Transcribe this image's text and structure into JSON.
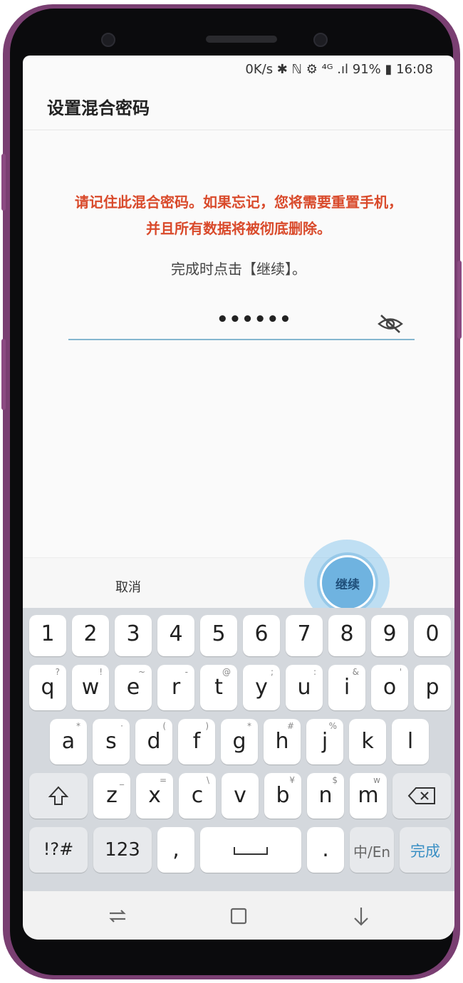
{
  "status_bar": {
    "text": "0K/s ✱ ℕ ⚙ ⁴ᴳ .ıl 91% ▮ 16:08",
    "battery": "91%",
    "time": "16:08"
  },
  "title": "设置混合密码",
  "warning_line1": "请记住此混合密码。如果忘记，您将需要重置手机，",
  "warning_line2": "并且所有数据将被彻底删除。",
  "hint": "完成时点击【继续】。",
  "password": {
    "masked_value": "••••••",
    "visibility_icon": "eye-off-icon"
  },
  "buttons": {
    "cancel": "取消",
    "continue": "继续"
  },
  "keyboard": {
    "row1": [
      "1",
      "2",
      "3",
      "4",
      "5",
      "6",
      "7",
      "8",
      "9",
      "0"
    ],
    "row2": [
      "q",
      "w",
      "e",
      "r",
      "t",
      "y",
      "u",
      "i",
      "o",
      "p"
    ],
    "row2_sub": [
      "?",
      "!",
      "~",
      "-",
      "@",
      ";",
      ":",
      "&",
      "'",
      ""
    ],
    "row3": [
      "a",
      "s",
      "d",
      "f",
      "g",
      "h",
      "j",
      "k",
      "l"
    ],
    "row3_sub": [
      "*",
      "·",
      "(",
      ")",
      "*",
      "#",
      "%",
      "",
      ""
    ],
    "row4": [
      "z",
      "x",
      "c",
      "v",
      "b",
      "n",
      "m"
    ],
    "row4_sub": [
      "_",
      "=",
      "\\",
      "",
      "¥",
      "$",
      "w"
    ],
    "symbols": "!?#",
    "numbers": "123",
    "comma": ",",
    "period": ".",
    "lang": "中/En",
    "done": "完成"
  },
  "colors": {
    "accent": "#6fb3e0",
    "warning": "#d94a2b",
    "frame": "#7a3f72"
  },
  "nav_icons": [
    "recent-apps-icon",
    "home-icon",
    "back-icon"
  ]
}
